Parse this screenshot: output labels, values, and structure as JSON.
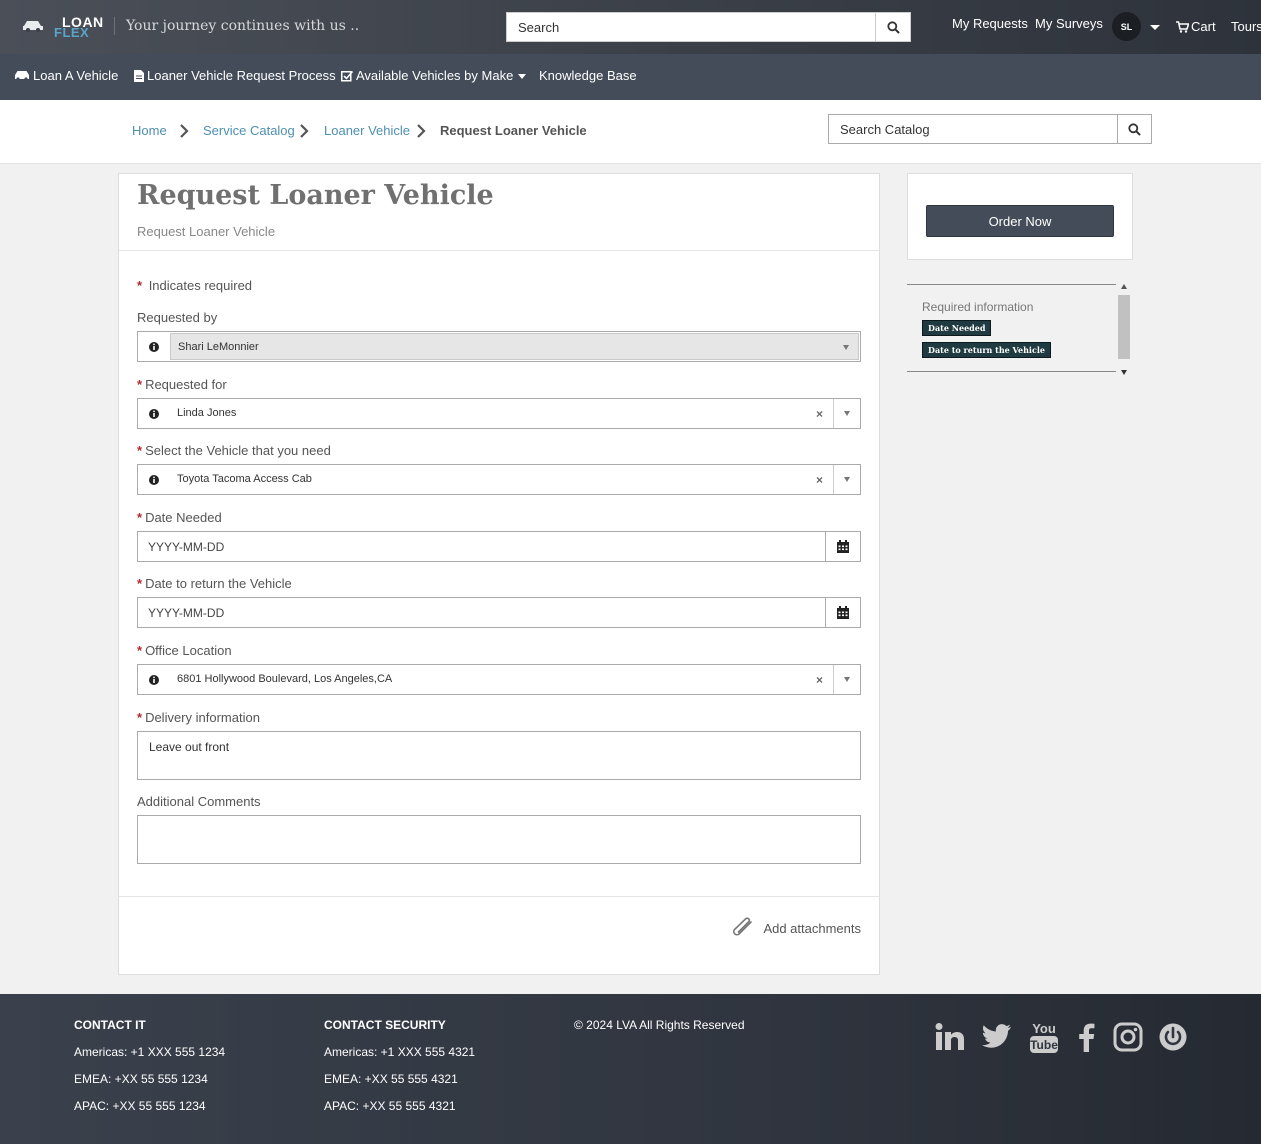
{
  "header": {
    "logo_top": "LOAN",
    "logo_bottom": "FLEX",
    "tagline": "Your journey continues with us ..",
    "search_placeholder": "Search",
    "links": [
      "My Requests",
      "My Surveys"
    ],
    "avatar_initials": "SL",
    "cart_label": "Cart",
    "tours_label": "Tours"
  },
  "nav": {
    "items": [
      "Loan A Vehicle",
      "Loaner Vehicle Request Process",
      "Available Vehicles by Make",
      "Knowledge Base"
    ]
  },
  "breadcrumb": {
    "items": [
      "Home",
      "Service Catalog",
      "Loaner Vehicle",
      "Request Loaner Vehicle"
    ],
    "catalog_search_placeholder": "Search Catalog"
  },
  "form": {
    "title": "Request Loaner Vehicle",
    "subtitle": "Request Loaner Vehicle",
    "required_marker": "*",
    "required_note": "Indicates required",
    "requested_by_label": "Requested by",
    "requested_by_value": "Shari LeMonnier",
    "requested_for_label": "Requested for",
    "requested_for_value": "Linda Jones",
    "vehicle_label": "Select the Vehicle that you need",
    "vehicle_value": "Toyota Tacoma Access Cab",
    "date_needed_label": "Date Needed",
    "date_needed_placeholder": "YYYY-MM-DD",
    "date_return_label": "Date to return the Vehicle",
    "date_return_placeholder": "YYYY-MM-DD",
    "office_label": "Office Location",
    "office_value": "6801 Hollywood Boulevard, Los Angeles,CA",
    "delivery_label": "Delivery information",
    "delivery_value": "Leave out front",
    "comments_label": "Additional Comments",
    "comments_value": "",
    "attachments_label": "Add attachments",
    "clear_glyph": "×"
  },
  "sidebar": {
    "order_button": "Order Now",
    "required_title": "Required information",
    "required_tags": [
      "Date Needed",
      "Date to return the Vehicle"
    ]
  },
  "footer": {
    "contact_it": {
      "heading": "CONTACT IT",
      "lines": [
        "Americas: +1 XXX 555 1234",
        "EMEA: +XX 55 555 1234",
        "APAC: +XX 55 555 1234"
      ]
    },
    "contact_security": {
      "heading": "CONTACT SECURITY",
      "lines": [
        "Americas: +1 XXX 555 4321",
        "EMEA: +XX 55 555 4321",
        "APAC: +XX 55 555 4321"
      ]
    },
    "copyright": "© 2024 LVA All Rights Reserved",
    "social_icons": [
      "linkedin-icon",
      "twitter-icon",
      "youtube-icon",
      "facebook-icon",
      "instagram-icon",
      "power-icon"
    ],
    "youtube_text_top": "You",
    "youtube_text_bottom": "Tube"
  },
  "colors": {
    "nav_bg": "#434c58",
    "link_blue": "#4e8fb0",
    "required_red": "#b5282e",
    "tag_bg": "#1f3a40"
  }
}
